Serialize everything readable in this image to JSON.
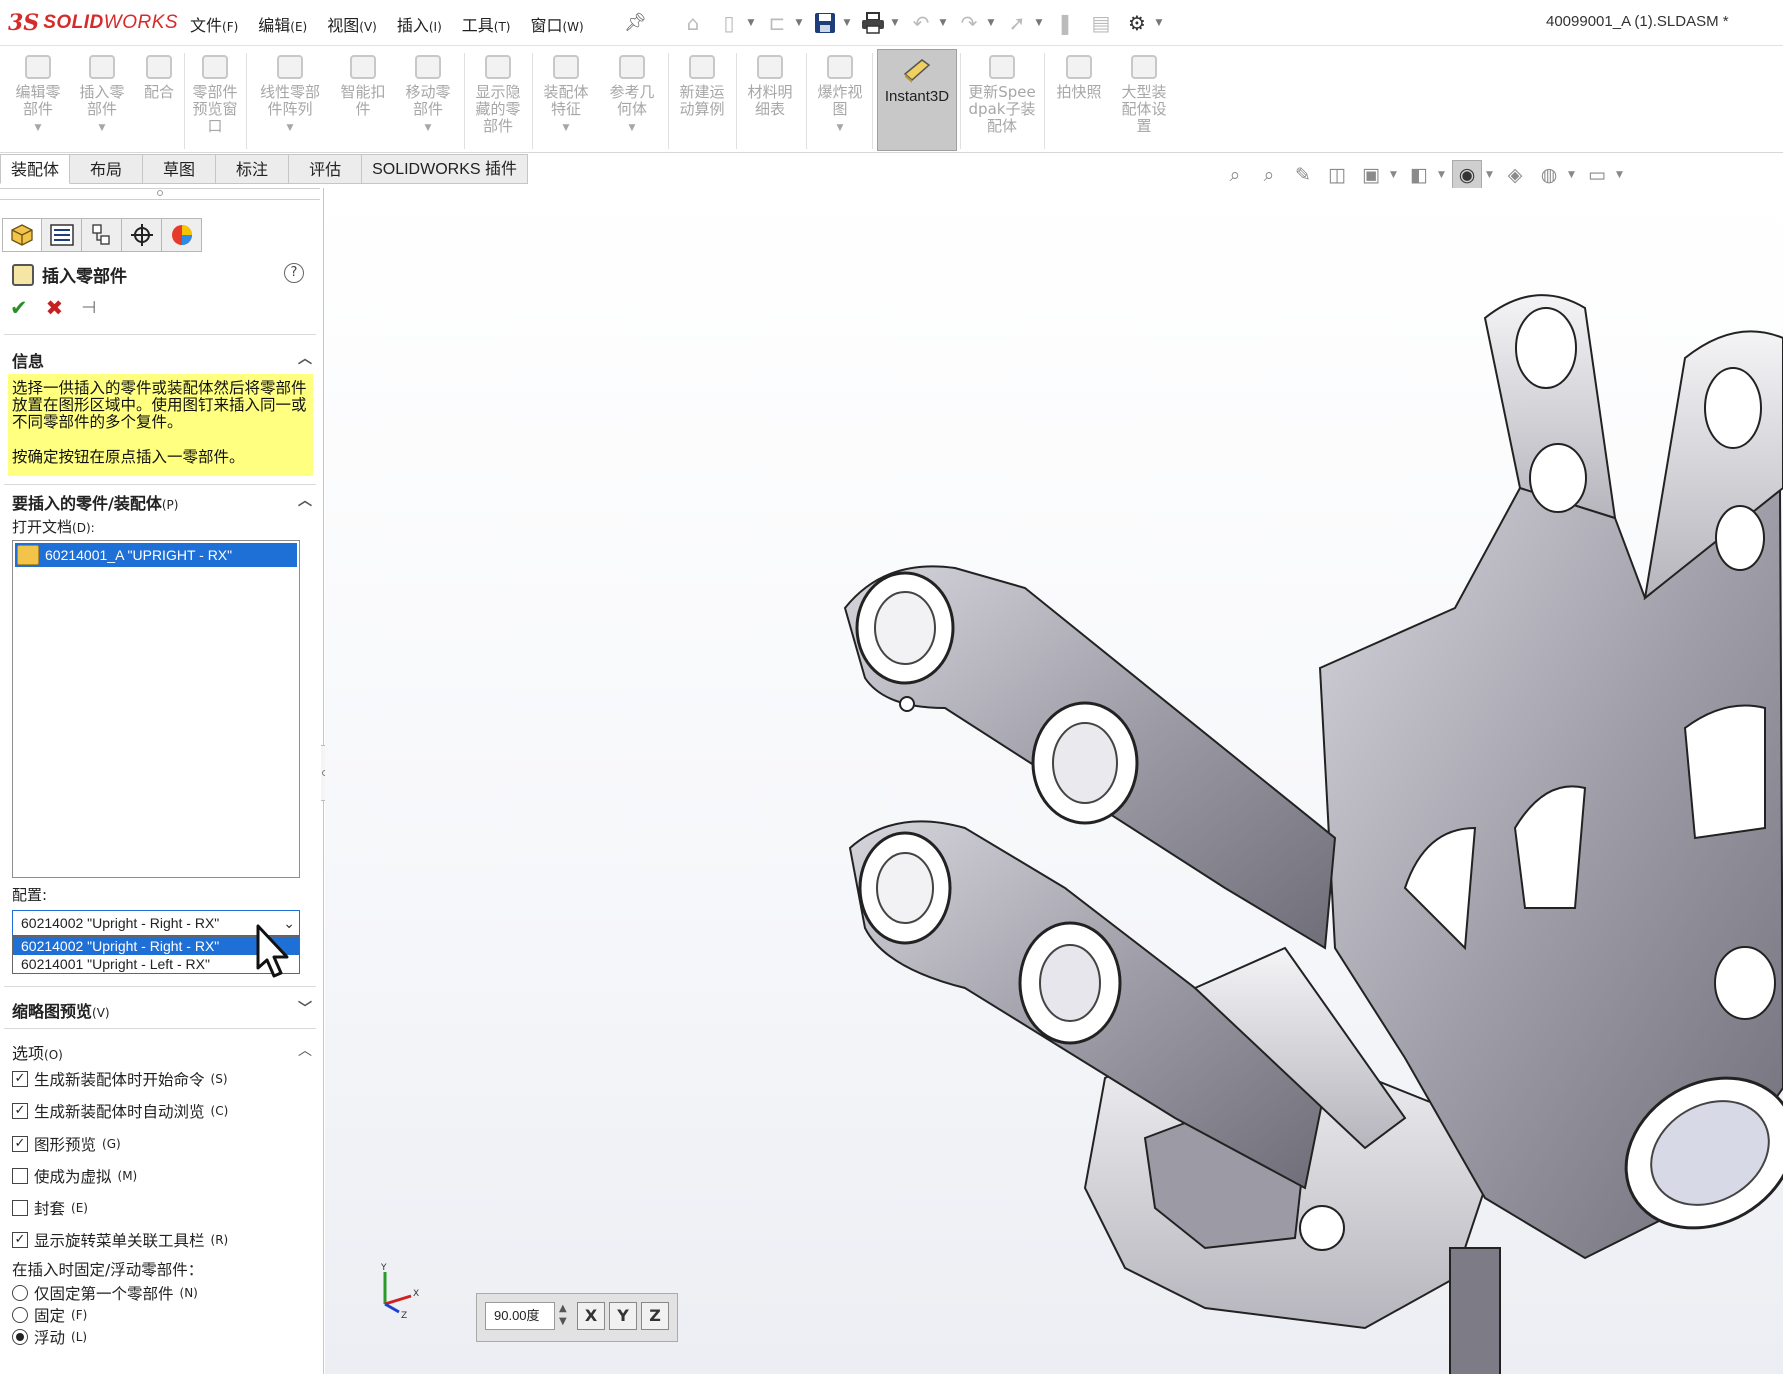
{
  "app": {
    "logo_ds": "3S",
    "logo_bold": "SOLID",
    "logo_light": "WORKS",
    "document_title": "40099001_A (1).SLDASM *"
  },
  "menu": [
    {
      "label": "文件",
      "key": "(F)"
    },
    {
      "label": "编辑",
      "key": "(E)"
    },
    {
      "label": "视图",
      "key": "(V)"
    },
    {
      "label": "插入",
      "key": "(I)"
    },
    {
      "label": "工具",
      "key": "(T)"
    },
    {
      "label": "窗口",
      "key": "(W)"
    }
  ],
  "quick_access": {
    "icons": [
      "home-icon",
      "new-document-icon",
      "open-icon",
      "save-icon",
      "print-icon",
      "undo-icon",
      "redo-icon",
      "select-icon",
      "rebuild-icon",
      "file-properties-icon",
      "options-icon"
    ]
  },
  "ribbon": {
    "buttons": [
      {
        "label": "编辑零部件",
        "has_arrow": true
      },
      {
        "label": "插入零部件",
        "has_arrow": true
      },
      {
        "label": "配合",
        "has_arrow": false
      },
      {
        "label": "零部件预览窗口",
        "has_arrow": false
      },
      {
        "label": "线性零部件阵列",
        "has_arrow": true
      },
      {
        "label": "智能扣件",
        "has_arrow": false
      },
      {
        "label": "移动零部件",
        "has_arrow": true
      },
      {
        "label": "显示隐藏的零部件",
        "has_arrow": false
      },
      {
        "label": "装配体特征",
        "has_arrow": true
      },
      {
        "label": "参考几何体",
        "has_arrow": true
      },
      {
        "label": "新建运动算例",
        "has_arrow": false
      },
      {
        "label": "材料明细表",
        "has_arrow": false
      },
      {
        "label": "爆炸视图",
        "has_arrow": true
      },
      {
        "label": "Instant3D",
        "has_arrow": false,
        "active": true
      },
      {
        "label": "更新Speedpak子装配体",
        "has_arrow": false
      },
      {
        "label": "拍快照",
        "has_arrow": false
      },
      {
        "label": "大型装配体设置",
        "has_arrow": false
      }
    ]
  },
  "tabs": [
    "装配体",
    "布局",
    "草图",
    "标注",
    "评估",
    "SOLIDWORKS 插件"
  ],
  "panel": {
    "title": "插入零部件",
    "help": "?",
    "ok": "✔",
    "cancel": "✖",
    "info_header": "信息",
    "info_text_1": "选择一供插入的零件或装配体然后将零部件放置在图形区域中。使用图钉来插入同一或不同零部件的多个复件。",
    "info_text_2": "按确定按钮在原点插入一零部件。",
    "part_header": "要插入的零件/装配体",
    "part_header_key": "(P)",
    "open_docs_label": "打开文档",
    "open_docs_key": "(D):",
    "open_docs": [
      "60214001_A \"UPRIGHT - RX\""
    ],
    "config_label": "配置:",
    "config_selected": "60214002 \"Upright - Right - RX\"",
    "config_options": [
      "60214002 \"Upright - Right - RX\"",
      "60214001 \"Upright - Left - RX\""
    ],
    "thumb_header": "缩略图预览",
    "thumb_header_key": "(V)",
    "options_header": "选项",
    "options_header_key": "(O)",
    "options": [
      {
        "label": "生成新装配体时开始命令",
        "key": "(S)",
        "checked": true
      },
      {
        "label": "生成新装配体时自动浏览",
        "key": "(C)",
        "checked": true
      },
      {
        "label": "图形预览",
        "key": "(G)",
        "checked": true
      },
      {
        "label": "使成为虚拟",
        "key": "(M)",
        "checked": false
      },
      {
        "label": "封套",
        "key": "(E)",
        "checked": false
      },
      {
        "label": "显示旋转菜单关联工具栏",
        "key": "(R)",
        "checked": true
      }
    ],
    "fix_label": "在插入时固定/浮动零部件：",
    "fix_options": [
      {
        "label": "仅固定第一个零部件",
        "key": "(N)",
        "selected": false
      },
      {
        "label": "固定",
        "key": "(F)",
        "selected": false
      },
      {
        "label": "浮动",
        "key": "(L)",
        "selected": true
      }
    ]
  },
  "rotate_toolbar": {
    "angle": "90.00度",
    "buttons": [
      "X",
      "Y",
      "Z"
    ]
  },
  "triad": {
    "x": "X",
    "y": "Y",
    "z": "Z"
  },
  "colors": {
    "accent": "#1e6fd6",
    "info_bg": "#ffff80",
    "logo": "#d62b2b"
  }
}
